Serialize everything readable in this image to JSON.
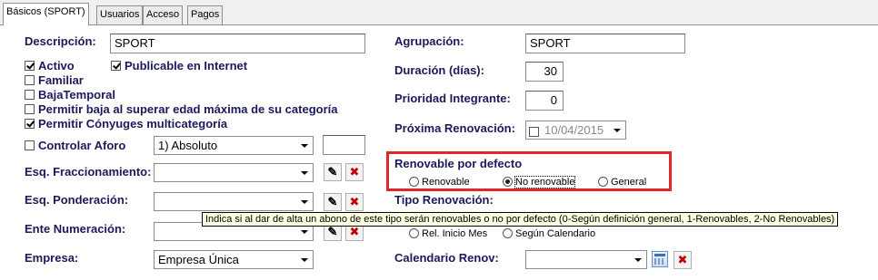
{
  "tabs": [
    {
      "label": "Básicos (SPORT)",
      "active": true
    },
    {
      "label": "Usuarios",
      "active": false
    },
    {
      "label": "Acceso",
      "active": false
    },
    {
      "label": "Pagos",
      "active": false
    }
  ],
  "left": {
    "descripcion_label": "Descripción:",
    "descripcion_value": "SPORT",
    "checkboxes": [
      {
        "label": "Activo",
        "checked": true
      },
      {
        "label": "Publicable en Internet",
        "checked": true
      },
      {
        "label": "Familiar",
        "checked": false
      },
      {
        "label": "BajaTemporal",
        "checked": false
      },
      {
        "label": "Permitir baja al superar edad máxima de su categoría",
        "checked": false
      },
      {
        "label": "Permitir Cónyuges multicategoría",
        "checked": true
      }
    ],
    "aforo_label": "Controlar Aforo",
    "aforo_checked": false,
    "aforo_select": "1) Absoluto",
    "aforo_value": "",
    "fraccionamiento_label": "Esq. Fraccionamiento:",
    "fraccionamiento_value": "",
    "ponderacion_label": "Esq. Ponderación:",
    "ponderacion_value": "",
    "numeracion_label": "Ente Numeración:",
    "numeracion_value": "",
    "empresa_label": "Empresa:",
    "empresa_value": "Empresa Única"
  },
  "right": {
    "agrupacion_label": "Agrupación:",
    "agrupacion_value": "SPORT",
    "duracion_label": "Duración (días):",
    "duracion_value": "30",
    "prioridad_label": "Prioridad Integrante:",
    "prioridad_value": "0",
    "proxima_label": "Próxima Renovación:",
    "proxima_value": "10/04/2015",
    "renovable_label": "Renovable por defecto",
    "renovable_options": [
      {
        "label": "Renovable",
        "selected": false
      },
      {
        "label": "No renovable",
        "selected": true
      },
      {
        "label": "General",
        "selected": false
      }
    ],
    "tipo_label": "Tipo Renovación:",
    "tipo_options": [
      {
        "label": "Rel. Inicio Mes",
        "selected": false
      },
      {
        "label": "Según Calendario",
        "selected": false
      }
    ],
    "calendario_label": "Calendario Renov:",
    "calendario_value": ""
  },
  "tooltip": "Indica si al dar de alta un abono de este tipo serán renovables o no por defecto (0-Según definición general, 1-Renovables, 2-No Renovables)",
  "colors": {
    "label": "#1a1a5c",
    "highlight_box": "#e2262c",
    "tooltip_bg": "#ffffe1",
    "delete_icon": "#c00000"
  }
}
